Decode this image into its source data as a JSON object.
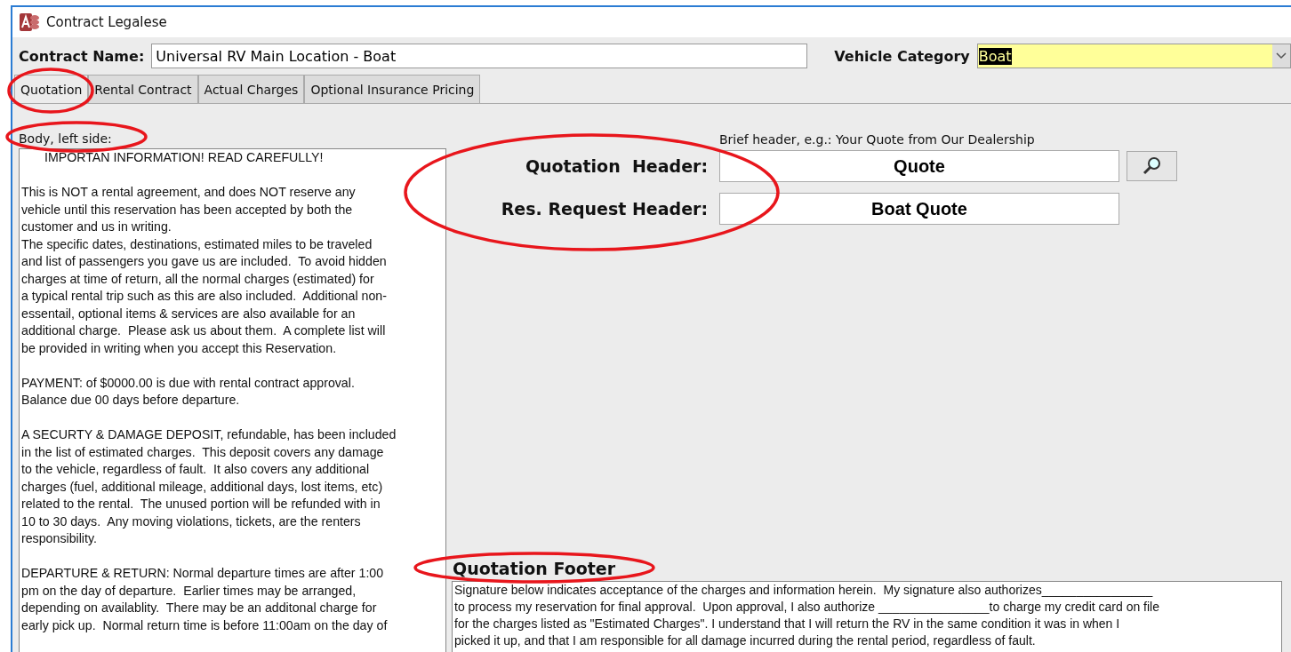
{
  "window": {
    "title": "Contract Legalese"
  },
  "contract_name": {
    "label": "Contract Name:",
    "value": "Universal RV Main Location - Boat"
  },
  "vehicle_category": {
    "label": "Vehicle Category",
    "value": "Boat"
  },
  "tabs": [
    {
      "label": "Quotation",
      "selected": true
    },
    {
      "label": "Rental Contract",
      "selected": false
    },
    {
      "label": "Actual Charges",
      "selected": false
    },
    {
      "label": "Optional Insurance Pricing",
      "selected": false
    }
  ],
  "body": {
    "label": "Body, left side:",
    "paragraphs": [
      [
        "IMPORTAN INFORMATION! READ CAREFULLY!"
      ],
      [
        "This is NOT a rental agreement, and does NOT reserve any",
        "vehicle until this reservation has been accepted by both the",
        "customer and us in writing.",
        "The specific dates, destinations, estimated miles to be traveled",
        "and list of passengers you gave us are included.  To avoid hidden",
        "charges at time of return, all the normal charges (estimated) for",
        "a typical rental trip such as this are also included.  Additional non-",
        "essentail, optional items & services are also available for an",
        "additional charge.  Please ask us about them.  A complete list will",
        "be provided in writing when you accept this Reservation."
      ],
      [
        "PAYMENT: of $0000.00 is due with rental contract approval.",
        "Balance due 00 days before departure."
      ],
      [
        "A SECURTY & DAMAGE DEPOSIT, refundable, has been included",
        "in the list of estimated charges.  This deposit covers any damage",
        "to the vehicle, regardless of fault.  It also covers any additional",
        "charges (fuel, additional mileage, additional days, lost items, etc)",
        "related to the rental.  The unused portion will be refunded with in",
        "10 to 30 days.  Any moving violations, tickets, are the renters",
        "responsibility."
      ],
      [
        "DEPARTURE & RETURN: Normal departure times are after 1:00",
        "pm on the day of departure.  Earlier times may be arranged,",
        "depending on availablity.  There may be an additonal charge for",
        "early pick up.  Normal return time is before 11:00am on the day of"
      ]
    ]
  },
  "hint": "Brief header, e.g.: Your Quote from Our Dealership",
  "headers": [
    {
      "label": "Quotation  Header:",
      "value": "Quote"
    },
    {
      "label": "Res. Request Header:",
      "value": "Boat Quote"
    }
  ],
  "footer": {
    "label": "Quotation Footer",
    "lines": [
      "Signature below indicates acceptance of the charges and information herein.  My signature also authorizes________________",
      "to process my reservation for final approval.  Upon approval, I also authorize ________________to charge my credit card on file",
      "for the charges listed as \"Estimated Charges\". I understand that I will return the RV in the same condition it was in when I",
      "picked it up, and that I am responsible for all damage incurred during the rental period, regardless of fault."
    ]
  }
}
